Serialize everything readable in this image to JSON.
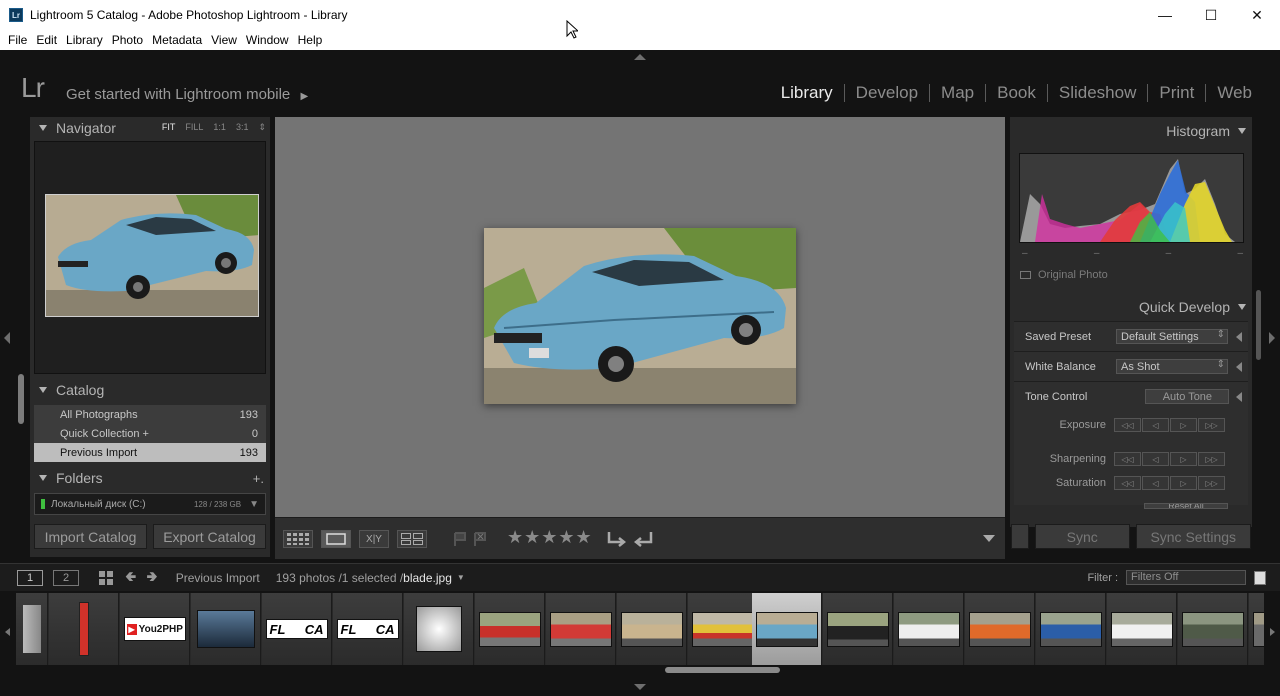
{
  "window": {
    "title": "Lightroom 5 Catalog - Adobe Photoshop Lightroom - Library",
    "badge": "Lr"
  },
  "menu": [
    "File",
    "Edit",
    "Library",
    "Photo",
    "Metadata",
    "View",
    "Window",
    "Help"
  ],
  "identity": {
    "logo": "Lr",
    "mobile_text": "Get started with Lightroom mobile"
  },
  "modules": [
    "Library",
    "Develop",
    "Map",
    "Book",
    "Slideshow",
    "Print",
    "Web"
  ],
  "active_module": "Library",
  "navigator": {
    "title": "Navigator",
    "zoom": [
      "FIT",
      "FILL",
      "1:1",
      "3:1"
    ],
    "active_zoom": "FIT"
  },
  "catalog": {
    "title": "Catalog",
    "items": [
      {
        "label": "All Photographs",
        "count": "193"
      },
      {
        "label": "Quick Collection  +",
        "count": "0"
      },
      {
        "label": "Previous Import",
        "count": "193"
      }
    ]
  },
  "folders": {
    "title": "Folders",
    "add": "+.",
    "drive": "Локальный диск (C:)",
    "drive_capacity": "128 / 238 GB"
  },
  "left_buttons": {
    "import": "Import Catalog",
    "export": "Export Catalog"
  },
  "histogram": {
    "title": "Histogram",
    "original_photo": "Original Photo",
    "dashes": [
      "–",
      "–",
      "–",
      "–"
    ]
  },
  "quick_develop": {
    "title": "Quick Develop",
    "saved_preset": {
      "label": "Saved Preset",
      "value": "Default Settings"
    },
    "white_balance": {
      "label": "White Balance",
      "value": "As Shot"
    },
    "tone_control": {
      "label": "Tone Control",
      "auto_tone": "Auto Tone"
    },
    "adjustments": [
      "Exposure",
      "Sharpening",
      "Saturation"
    ],
    "stepper": [
      "◁◁",
      "◁",
      "▷",
      "▷▷"
    ],
    "reset_all": "Reset All"
  },
  "right_buttons": {
    "sync": "Sync",
    "sync_settings": "Sync Settings"
  },
  "toolbar": {
    "stars": "★★★★★",
    "xy": "X|Y"
  },
  "filmstrip_bar": {
    "page1": "1",
    "page2": "2",
    "source": "Previous Import",
    "count_text": "193 photos /1 selected /",
    "filename": "blade.jpg",
    "filter_label": "Filter :",
    "filter_value": "Filters Off"
  },
  "filmstrip_labels": {
    "you2php": "You2PHP",
    "fl": "FL",
    "ca": "CA"
  },
  "colors": {
    "car_blue": "#6aa7c6",
    "accent": "#c8c8c8"
  }
}
